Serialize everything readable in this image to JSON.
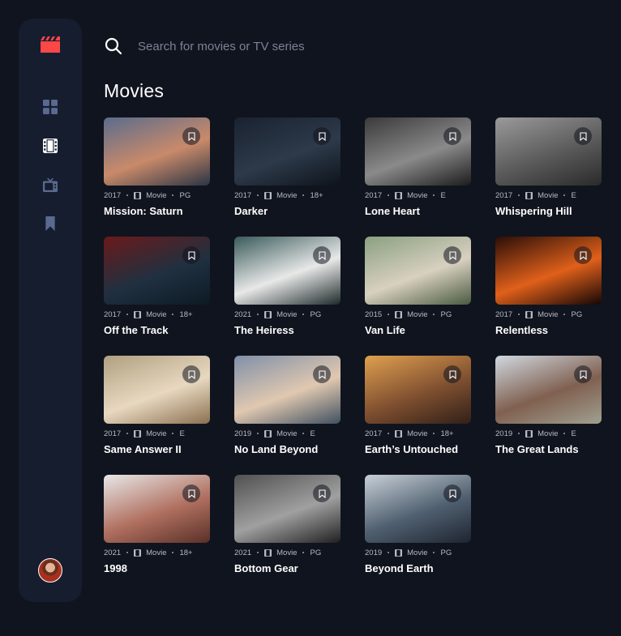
{
  "app": {
    "logo_icon": "film-clapper-icon",
    "accent": "#fc4747",
    "background": "#10141e",
    "sidebar_bg": "#161d2f"
  },
  "nav": {
    "items": [
      {
        "name": "home",
        "icon": "grid-icon",
        "active": false
      },
      {
        "name": "movies",
        "icon": "film-icon",
        "active": true
      },
      {
        "name": "tv-series",
        "icon": "tv-icon",
        "active": false
      },
      {
        "name": "bookmarks",
        "icon": "bookmark-icon",
        "active": false
      }
    ]
  },
  "search": {
    "placeholder": "Search for movies or TV series",
    "value": ""
  },
  "page": {
    "title": "Movies"
  },
  "movies": [
    {
      "title": "Mission: Saturn",
      "year": "2017",
      "category": "Movie",
      "rating": "PG",
      "thumb_colors": [
        "#5a6c8c",
        "#c98a6a",
        "#2b3444"
      ]
    },
    {
      "title": "Darker",
      "year": "2017",
      "category": "Movie",
      "rating": "18+",
      "thumb_colors": [
        "#1a2230",
        "#2d3a4a",
        "#0e131b"
      ]
    },
    {
      "title": "Lone Heart",
      "year": "2017",
      "category": "Movie",
      "rating": "E",
      "thumb_colors": [
        "#3a3a3a",
        "#8a8a8a",
        "#1c1c1c"
      ]
    },
    {
      "title": "Whispering Hill",
      "year": "2017",
      "category": "Movie",
      "rating": "E",
      "thumb_colors": [
        "#9a9a9a",
        "#5a5a5a",
        "#2a2a2a"
      ]
    },
    {
      "title": "Off the Track",
      "year": "2017",
      "category": "Movie",
      "rating": "18+",
      "thumb_colors": [
        "#6a1a1a",
        "#203040",
        "#0c1a24"
      ]
    },
    {
      "title": "The Heiress",
      "year": "2021",
      "category": "Movie",
      "rating": "PG",
      "thumb_colors": [
        "#3a5a5a",
        "#e8e8e8",
        "#1e2a2a"
      ]
    },
    {
      "title": "Van Life",
      "year": "2015",
      "category": "Movie",
      "rating": "PG",
      "thumb_colors": [
        "#8aa080",
        "#d8d0c0",
        "#4a5a40"
      ]
    },
    {
      "title": "Relentless",
      "year": "2017",
      "category": "Movie",
      "rating": "PG",
      "thumb_colors": [
        "#2a0e08",
        "#e0601a",
        "#140606"
      ]
    },
    {
      "title": "Same Answer II",
      "year": "2017",
      "category": "Movie",
      "rating": "E",
      "thumb_colors": [
        "#b0a080",
        "#e8d8c0",
        "#8a7050"
      ]
    },
    {
      "title": "No Land Beyond",
      "year": "2019",
      "category": "Movie",
      "rating": "E",
      "thumb_colors": [
        "#8090a8",
        "#e0c8b0",
        "#405060"
      ]
    },
    {
      "title": "Earth’s Untouched",
      "year": "2017",
      "category": "Movie",
      "rating": "18+",
      "thumb_colors": [
        "#e0a050",
        "#805030",
        "#302018"
      ]
    },
    {
      "title": "The Great Lands",
      "year": "2019",
      "category": "Movie",
      "rating": "E",
      "thumb_colors": [
        "#d0d8e0",
        "#806050",
        "#a0a090"
      ]
    },
    {
      "title": "1998",
      "year": "2021",
      "category": "Movie",
      "rating": "18+",
      "thumb_colors": [
        "#e8e8e8",
        "#b07060",
        "#5a3028"
      ]
    },
    {
      "title": "Bottom Gear",
      "year": "2021",
      "category": "Movie",
      "rating": "PG",
      "thumb_colors": [
        "#505050",
        "#a0a0a0",
        "#202020"
      ]
    },
    {
      "title": "Beyond Earth",
      "year": "2019",
      "category": "Movie",
      "rating": "PG",
      "thumb_colors": [
        "#c8d0d8",
        "#506070",
        "#1e2430"
      ]
    }
  ],
  "user": {
    "avatar_icon": "user-avatar"
  }
}
